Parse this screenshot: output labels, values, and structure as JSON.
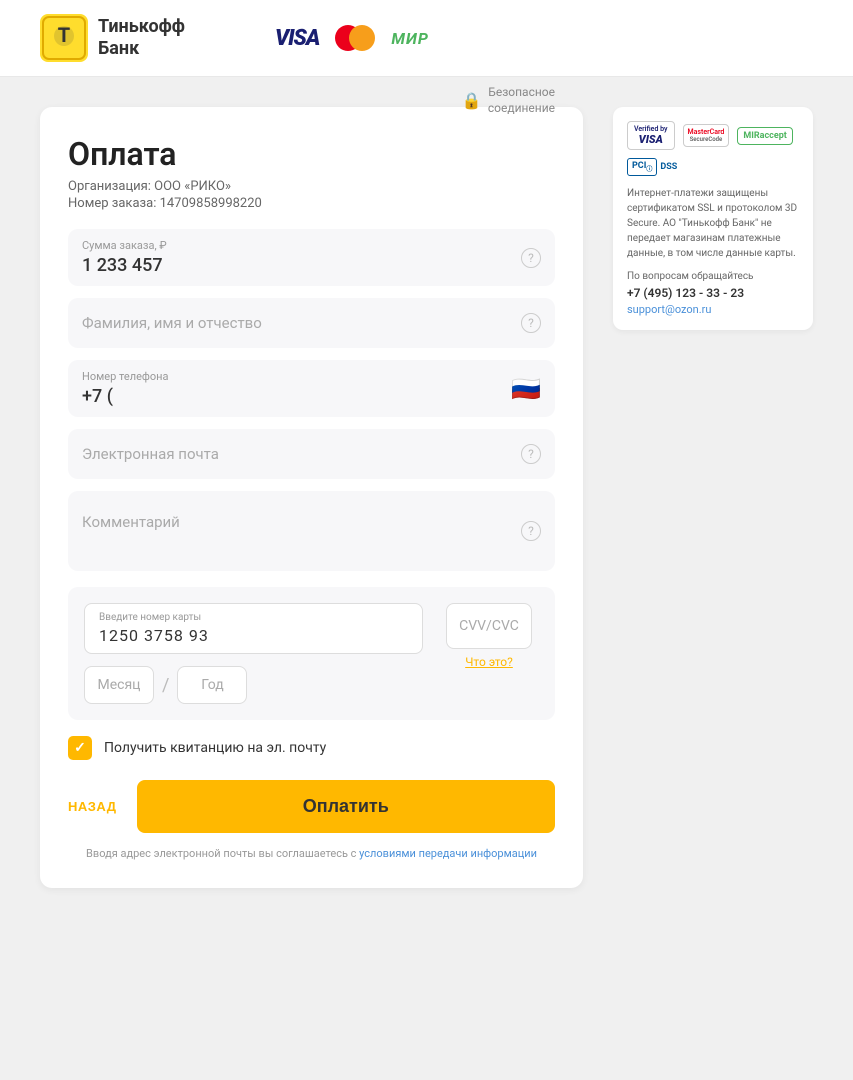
{
  "header": {
    "bank_name_line1": "Тинькофф",
    "bank_name_line2": "Банк",
    "visa_label": "VISA",
    "mir_label": "МИР"
  },
  "form": {
    "title": "Оплата",
    "secure_label": "Безопасное\nсоединение",
    "org_label": "Организация: ООО «РИКО»",
    "order_label": "Номер заказа: 14709858998220",
    "amount_field_label": "Сумма заказа, ₽",
    "amount_value": "1 233 457",
    "fullname_placeholder": "Фамилия, имя и отчество",
    "phone_label": "Номер телефона",
    "phone_value": "+7 (",
    "email_placeholder": "Электронная почта",
    "comment_placeholder": "Комментарий",
    "card_number_label": "Введите номер карты",
    "card_number_value": "1250  3758  93",
    "month_placeholder": "Месяц",
    "year_placeholder": "Год",
    "cvv_placeholder": "CVV/CVC",
    "cvv_link": "Что это?",
    "receipt_label": "Получить квитанцию на эл. почту",
    "back_btn": "НАЗАД",
    "pay_btn": "Оплатить",
    "terms_text": "Вводя адрес электронной почты вы соглашаетесь с ",
    "terms_link_text": "условиями передачи информации"
  },
  "sidebar": {
    "verified_visa_line1": "Verified by",
    "verified_visa_line2": "VISA",
    "mc_secure_line1": "MasterCard",
    "mc_secure_line2": "SecureCode",
    "mir_accept": "MIRaccept",
    "pci_label": "PCI",
    "dss_label": "DSS",
    "security_desc": "Интернет-платежи защищены сертификатом SSL и протоколом 3D Secure. АО \"Тинькофф Банк\" не передает магазинам платежные данные, в том числе данные карты.",
    "support_label": "По вопросам обращайтесь",
    "support_phone": "+7 (495) 123 - 33 - 23",
    "support_email": "support@ozon.ru"
  }
}
